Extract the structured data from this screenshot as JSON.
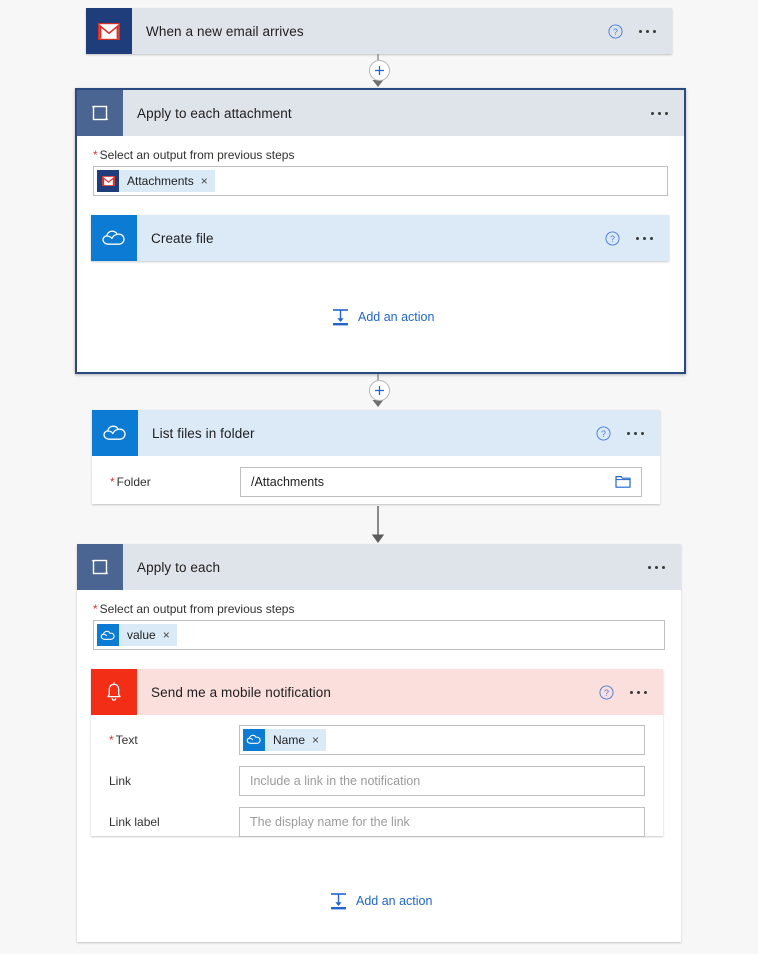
{
  "canvas": {
    "background": "#f7f7f7"
  },
  "palette": {
    "gmail_bg": "#1f3d7a",
    "onedrive_bg": "#0b7bd4",
    "loop_bg": "#4a6591",
    "bell_bg": "#f22e17",
    "header_grey": "#dfe3ea",
    "header_blue": "#dce9f7",
    "header_pink": "#fbdfdd",
    "link_blue": "#2266cc",
    "required_red": "#d13438",
    "scope_border": "#2b4a80",
    "token_chip": "#dbeaf7"
  },
  "flow": {
    "trigger": {
      "title": "When a new email arrives",
      "icon": "gmail-icon",
      "help_icon": "help-icon",
      "menu_icon": "ellipsis-icon"
    },
    "apply_to_each_attachment": {
      "title": "Apply to each attachment",
      "icon": "loop-icon",
      "menu_icon": "ellipsis-icon",
      "output_label": "Select an output from previous steps",
      "output_token": {
        "text": "Attachments",
        "icon": "gmail-icon",
        "remove": "×"
      },
      "child_action": {
        "title": "Create file",
        "icon": "onedrive-icon",
        "help_icon": "help-icon",
        "menu_icon": "ellipsis-icon"
      },
      "add_action_label": "Add an action",
      "add_action_icon": "add-action-icon"
    },
    "list_files": {
      "title": "List files in folder",
      "icon": "onedrive-icon",
      "help_icon": "help-icon",
      "menu_icon": "ellipsis-icon",
      "field_label": "Folder",
      "field_value": "/Attachments",
      "field_picker_icon": "folder-picker-icon"
    },
    "apply_to_each": {
      "title": "Apply to each",
      "icon": "loop-icon",
      "menu_icon": "ellipsis-icon",
      "output_label": "Select an output from previous steps",
      "output_token": {
        "text": "value",
        "icon": "onedrive-icon",
        "remove": "×"
      },
      "child_action": {
        "title": "Send me a mobile notification",
        "icon": "bell-icon",
        "help_icon": "help-icon",
        "menu_icon": "ellipsis-icon",
        "fields": [
          {
            "label": "Text",
            "required": true,
            "token": {
              "text": "Name",
              "icon": "onedrive-icon",
              "remove": "×"
            },
            "placeholder": ""
          },
          {
            "label": "Link",
            "required": false,
            "placeholder": "Include a link in the notification"
          },
          {
            "label": "Link label",
            "required": false,
            "placeholder": "The display name for the link"
          }
        ]
      },
      "add_action_label": "Add an action",
      "add_action_icon": "add-action-icon"
    },
    "connectors": [
      {
        "name": "connector-trigger-to-loop",
        "has_plus": true,
        "plus_icon": "plus-icon"
      },
      {
        "name": "connector-loop-to-listfiles",
        "has_plus": true,
        "plus_icon": "plus-icon"
      },
      {
        "name": "connector-listfiles-to-applytoeach",
        "has_plus": false
      }
    ]
  }
}
